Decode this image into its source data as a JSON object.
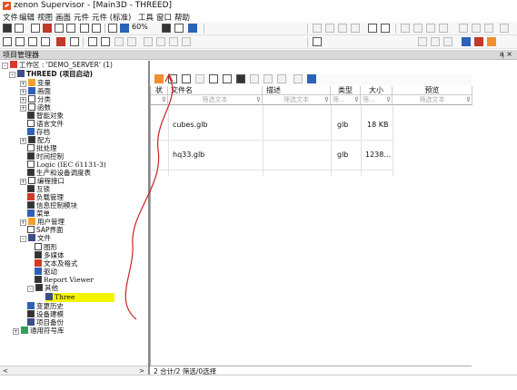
{
  "window": {
    "title": "zenon Supervisor - [Main3D - THREED]"
  },
  "menu": {
    "items": [
      "文件",
      "编辑",
      "视图",
      "画面",
      "元件",
      "元件 (标准)",
      "工具",
      "窗口",
      "帮助"
    ]
  },
  "toolbar": {
    "zoom_value": "60%"
  },
  "project_manager": {
    "title": "项目管理器",
    "header_buttons": "ą ×"
  },
  "tree": {
    "workspace": "工作区 : 'DEMO_SERVER' (1)",
    "project": "THREED (项目启动)",
    "items": [
      "变量",
      "画面",
      "分类",
      "函数",
      "智能对象",
      "语言文件",
      "存档",
      "配方",
      "批处理",
      "时间控制",
      "Logic (IEC 61131-3)",
      "生产和设备调度表",
      "编程接口",
      "互锁",
      "负载管理",
      "信息控制模块",
      "菜单",
      "用户管理",
      "SAP界面",
      "文件",
      "图形",
      "多媒体",
      "文本及格式",
      "驱动",
      "Report Viewer",
      "其他",
      "Three",
      "变更历史",
      "设备建模",
      "项目备份"
    ],
    "global_library": "通用符号库"
  },
  "file_table": {
    "columns": [
      "状",
      "文件名",
      "描述",
      "类型",
      "大小",
      "预览"
    ],
    "filter_placeholders": [
      "",
      "筛选文本",
      "筛选文本",
      "筛...",
      "筛...",
      "筛选文本"
    ],
    "rows": [
      {
        "name": "cubes.glb",
        "desc": "",
        "type": "glb",
        "size": "18 KB",
        "preview": ""
      },
      {
        "name": "hq33.glb",
        "desc": "",
        "type": "glb",
        "size": "1238...",
        "preview": ""
      }
    ]
  },
  "status": {
    "text": "2 合计/2 筛选/0选择"
  },
  "colors": {
    "highlight": "#f4f400",
    "annotation_arrow": "#cc2222",
    "zenon_orange": "#e8501a"
  }
}
